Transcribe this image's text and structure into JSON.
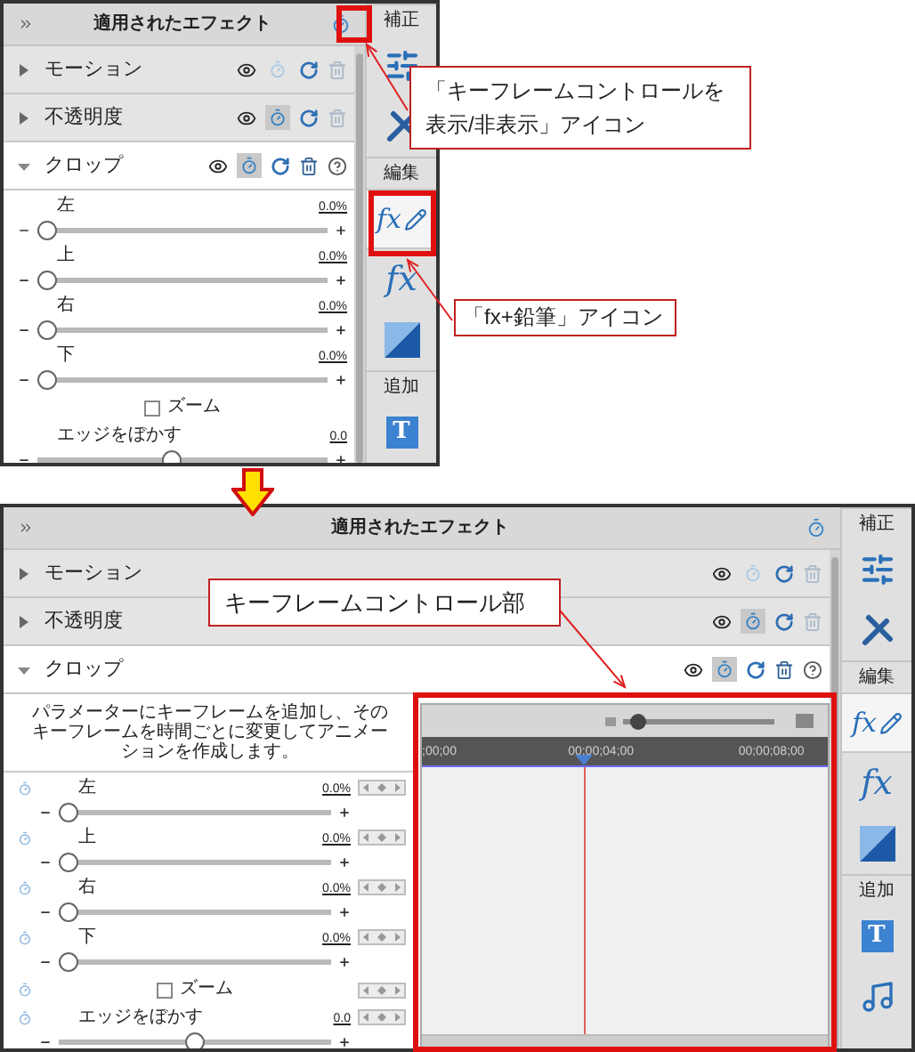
{
  "top_screen": {
    "panel_title": "適用されたエフェクト",
    "effects": [
      {
        "name": "モーション",
        "expanded": false,
        "keyframes": false,
        "help": false
      },
      {
        "name": "不透明度",
        "expanded": false,
        "keyframes": true,
        "help": false
      },
      {
        "name": "クロップ",
        "expanded": true,
        "keyframes": true,
        "help": true,
        "params": [
          {
            "kind": "slider",
            "label": "左",
            "value": "0.0%",
            "level": 0
          },
          {
            "kind": "slider",
            "label": "上",
            "value": "0.0%",
            "level": 0
          },
          {
            "kind": "slider",
            "label": "右",
            "value": "0.0%",
            "level": 0
          },
          {
            "kind": "slider",
            "label": "下",
            "value": "0.0%",
            "level": 0
          },
          {
            "kind": "checkbox",
            "label": "ズーム",
            "checked": false
          },
          {
            "kind": "slider",
            "label": "エッジをぼかす",
            "value": "0.0",
            "level": 0.46
          }
        ]
      }
    ],
    "sidebar": [
      {
        "kind": "heading",
        "label": "補正"
      },
      {
        "kind": "adjust",
        "selected": false
      },
      {
        "kind": "tools",
        "selected": false
      },
      {
        "kind": "heading",
        "label": "編集"
      },
      {
        "kind": "fx-pencil",
        "text": "fx",
        "selected": true
      },
      {
        "kind": "fx",
        "text": "fx",
        "selected": false
      },
      {
        "kind": "color",
        "selected": false
      },
      {
        "kind": "heading",
        "label": "追加"
      },
      {
        "kind": "title",
        "text": "T",
        "selected": false
      }
    ]
  },
  "bottom_screen": {
    "panel_title": "適用されたエフェクト",
    "effects": [
      {
        "name": "モーション",
        "expanded": false,
        "keyframes": false,
        "help": false
      },
      {
        "name": "不透明度",
        "expanded": false,
        "keyframes": true,
        "help": false
      },
      {
        "name": "クロップ",
        "expanded": true,
        "keyframes": true,
        "help": true,
        "description": "パラメーターにキーフレームを追加し、そのキーフレームを時間ごとに変更してアニメーションを作成します。",
        "params": [
          {
            "kind": "slider",
            "label": "左",
            "value": "0.0%",
            "level": 0
          },
          {
            "kind": "slider",
            "label": "上",
            "value": "0.0%",
            "level": 0
          },
          {
            "kind": "slider",
            "label": "右",
            "value": "0.0%",
            "level": 0
          },
          {
            "kind": "slider",
            "label": "下",
            "value": "0.0%",
            "level": 0
          },
          {
            "kind": "checkbox",
            "label": "ズーム",
            "checked": false
          },
          {
            "kind": "slider",
            "label": "エッジをぼかす",
            "value": "0.0",
            "level": 0.5
          }
        ]
      }
    ],
    "keyframe_panel": {
      "zoom": {
        "level": 0.05
      },
      "timecodes": [
        ";00;00",
        "00;00;04;00",
        "00;00;08;00"
      ],
      "playhead": {
        "level": 0.4
      }
    },
    "sidebar": [
      {
        "kind": "heading",
        "label": "補正"
      },
      {
        "kind": "adjust",
        "selected": false
      },
      {
        "kind": "tools",
        "selected": false
      },
      {
        "kind": "heading",
        "label": "編集"
      },
      {
        "kind": "fx-pencil",
        "text": "fx",
        "selected": true
      },
      {
        "kind": "fx",
        "text": "fx",
        "selected": false
      },
      {
        "kind": "color",
        "selected": false
      },
      {
        "kind": "heading",
        "label": "追加"
      },
      {
        "kind": "title",
        "text": "T",
        "selected": false
      },
      {
        "kind": "music",
        "selected": false
      }
    ]
  },
  "callouts": [
    {
      "text": "「キーフレームコントロールを表示/非表示」アイコン"
    },
    {
      "text": "「fx+鉛筆」アイコン"
    },
    {
      "text": "キーフレームコントロール部"
    }
  ]
}
